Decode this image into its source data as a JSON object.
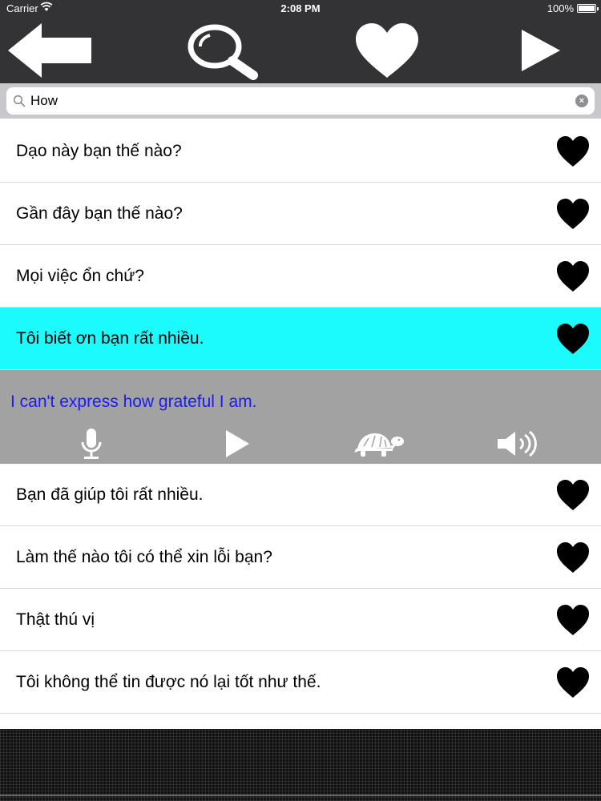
{
  "status_bar": {
    "carrier": "Carrier",
    "time": "2:08 PM",
    "battery": "100%",
    "icons": [
      "wifi-icon",
      "battery-icon"
    ]
  },
  "toolbar": {
    "buttons": [
      {
        "name": "back",
        "icon": "back-arrow-icon"
      },
      {
        "name": "search",
        "icon": "search-icon"
      },
      {
        "name": "favorites",
        "icon": "heart-icon"
      },
      {
        "name": "play",
        "icon": "play-icon"
      }
    ]
  },
  "search": {
    "value": "How",
    "icon": "search-icon",
    "clear_icon": "clear-icon"
  },
  "phrases": [
    {
      "text": "Dạo này bạn thế nào?"
    },
    {
      "text": "Gần đây bạn thế nào?"
    },
    {
      "text": "Mọi việc ổn chứ?"
    },
    {
      "text": "Tôi biết ơn bạn rất nhiều."
    },
    {
      "text": "Bạn đã giúp tôi rất nhiều."
    },
    {
      "text": "Làm thế nào tôi có thể xin lỗi bạn?"
    },
    {
      "text": "Thật thú vị"
    },
    {
      "text": "Tôi không thể tin được nó lại tốt như thế."
    }
  ],
  "selected_index": 3,
  "detail": {
    "translation": "I can't express how grateful I am.",
    "controls": [
      "microphone-icon",
      "play-icon",
      "turtle-icon",
      "speaker-icon"
    ]
  },
  "colors": {
    "toolbar_bg": "#333335",
    "selected_row": "#1bfafc",
    "detail_bg": "#a2a2a2",
    "translation_text": "#1a1aff"
  }
}
